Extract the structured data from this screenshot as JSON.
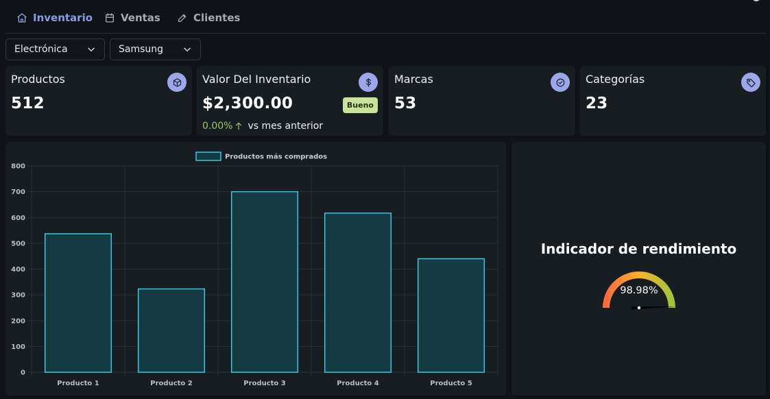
{
  "nav": {
    "tabs": [
      {
        "label": "Inventario",
        "icon": "home-icon",
        "active": true
      },
      {
        "label": "Ventas",
        "icon": "calendar-icon",
        "active": false
      },
      {
        "label": "Clientes",
        "icon": "pencil-icon",
        "active": false
      }
    ]
  },
  "filters": {
    "category": "Electrónica",
    "brand": "Samsung"
  },
  "cards": {
    "products": {
      "title": "Productos",
      "value": "512",
      "icon": "box-icon"
    },
    "inventory": {
      "title": "Valor Del Inventario",
      "value": "$2,300.00",
      "icon": "dollar-icon",
      "badge": "Bueno",
      "trend_pct": "0.00%",
      "trend_text": "vs mes anterior"
    },
    "brands": {
      "title": "Marcas",
      "value": "53",
      "icon": "check-circle-icon"
    },
    "categories": {
      "title": "Categorías",
      "value": "23",
      "icon": "tag-icon"
    }
  },
  "chart_data": {
    "type": "bar",
    "legend": "Productos más comprados",
    "categories": [
      "Producto 1",
      "Producto 2",
      "Producto 3",
      "Producto 4",
      "Producto 5"
    ],
    "values": [
      537,
      323,
      700,
      617,
      440
    ],
    "ylim": [
      0,
      800
    ],
    "yticks": [
      0,
      100,
      200,
      300,
      400,
      500,
      600,
      700,
      800
    ],
    "grid": true,
    "legend_position": "top",
    "bar_fill": "#143b44",
    "bar_stroke": "#3cc8dc"
  },
  "gauge": {
    "title": "Indicador de rendimiento",
    "value_label": "98.98%",
    "value": 98.98
  },
  "colors": {
    "accent": "#8b9be8",
    "badge": "#c9e39a",
    "trend_up": "#9ac46a"
  }
}
